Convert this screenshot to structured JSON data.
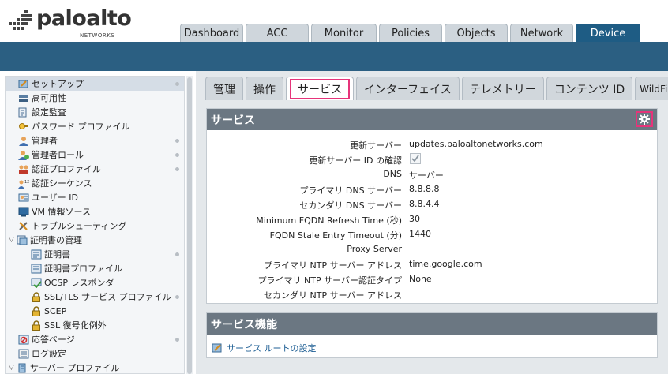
{
  "brand": {
    "name": "paloalto",
    "sub": "NETWORKS"
  },
  "main_tabs": [
    {
      "label": "Dashboard",
      "active": false
    },
    {
      "label": "ACC",
      "active": false
    },
    {
      "label": "Monitor",
      "active": false
    },
    {
      "label": "Policies",
      "active": false
    },
    {
      "label": "Objects",
      "active": false
    },
    {
      "label": "Network",
      "active": false
    },
    {
      "label": "Device",
      "active": true
    }
  ],
  "tree": [
    {
      "label": "セットアップ",
      "icon": "setup-icon",
      "level": 0,
      "selected": true,
      "dot": true
    },
    {
      "label": "高可用性",
      "icon": "high-availability-icon",
      "level": 0,
      "dot": false
    },
    {
      "label": "設定監査",
      "icon": "config-audit-icon",
      "level": 0,
      "dot": false
    },
    {
      "label": "パスワード プロファイル",
      "icon": "password-profile-icon",
      "level": 0,
      "dot": false
    },
    {
      "label": "管理者",
      "icon": "administrator-icon",
      "level": 0,
      "dot": true
    },
    {
      "label": "管理者ロール",
      "icon": "admin-role-icon",
      "level": 0,
      "dot": true
    },
    {
      "label": "認証プロファイル",
      "icon": "auth-profile-icon",
      "level": 0,
      "dot": true
    },
    {
      "label": "認証シーケンス",
      "icon": "auth-sequence-icon",
      "level": 0,
      "dot": false
    },
    {
      "label": "ユーザー ID",
      "icon": "user-id-icon",
      "level": 0,
      "dot": false
    },
    {
      "label": "VM 情報ソース",
      "icon": "vm-info-icon",
      "level": 0,
      "dot": false
    },
    {
      "label": "トラブルシューティング",
      "icon": "troubleshooting-icon",
      "level": 0,
      "dot": false
    },
    {
      "label": "証明書の管理",
      "icon": "cert-management-icon",
      "level": 0,
      "caret": true,
      "dot": false
    },
    {
      "label": "証明書",
      "icon": "certificate-icon",
      "level": 1,
      "dot": true
    },
    {
      "label": "証明書プロファイル",
      "icon": "cert-profile-icon",
      "level": 1,
      "dot": false
    },
    {
      "label": "OCSP レスポンダ",
      "icon": "ocsp-icon",
      "level": 1,
      "dot": false
    },
    {
      "label": "SSL/TLS サービス プロファイル",
      "icon": "lock-icon",
      "level": 1,
      "dot": true
    },
    {
      "label": "SCEP",
      "icon": "lock-icon",
      "level": 1,
      "dot": false
    },
    {
      "label": "SSL 復号化例外",
      "icon": "lock-icon",
      "level": 1,
      "dot": false
    },
    {
      "label": "応答ページ",
      "icon": "response-page-icon",
      "level": 0,
      "dot": true
    },
    {
      "label": "ログ設定",
      "icon": "log-settings-icon",
      "level": 0,
      "dot": false
    },
    {
      "label": "サーバー プロファイル",
      "icon": "server-profile-icon",
      "level": 0,
      "caret": true,
      "dot": false
    }
  ],
  "sub_tabs": [
    {
      "label": "管理",
      "active": false
    },
    {
      "label": "操作",
      "active": false
    },
    {
      "label": "サービス",
      "active": true
    },
    {
      "label": "インターフェイス",
      "active": false
    },
    {
      "label": "テレメトリー",
      "active": false
    },
    {
      "label": "コンテンツ ID",
      "active": false
    },
    {
      "label": "WildFire",
      "active": false
    }
  ],
  "services_panel": {
    "title": "サービス",
    "rows": [
      {
        "key": "更新サーバー",
        "value": "updates.paloaltonetworks.com"
      },
      {
        "key": "更新サーバー ID の確認",
        "value": "",
        "checkbox": true
      },
      {
        "key": "DNS",
        "value": "サーバー"
      },
      {
        "key": "プライマリ DNS サーバー",
        "value": "8.8.8.8"
      },
      {
        "key": "セカンダリ DNS サーバー",
        "value": "8.8.4.4"
      },
      {
        "key": "Minimum FQDN Refresh Time (秒)",
        "value": "30"
      },
      {
        "key": "FQDN Stale Entry Timeout (分)",
        "value": "1440"
      },
      {
        "key": "Proxy Server",
        "value": ""
      },
      {
        "key": "プライマリ NTP サーバー アドレス",
        "value": "time.google.com"
      },
      {
        "key": "プライマリ NTP サーバー認証タイプ",
        "value": "None"
      },
      {
        "key": "セカンダリ NTP サーバー アドレス",
        "value": ""
      }
    ]
  },
  "features_panel": {
    "title": "サービス機能",
    "link": "サービス ルートの設定"
  },
  "colors": {
    "accent": "#1e5c84",
    "band": "#2b5f82",
    "highlight": "#e6347a",
    "panel_header": "#6b7782"
  }
}
